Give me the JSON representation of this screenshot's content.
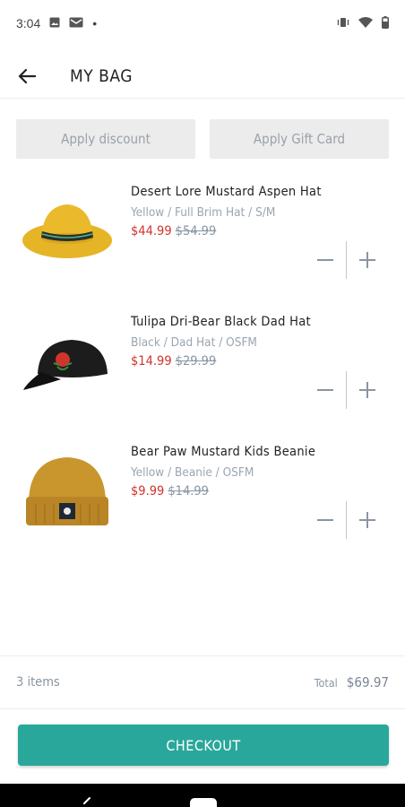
{
  "status_bar": {
    "time": "3:04",
    "dot": "•"
  },
  "header": {
    "title": "MY BAG"
  },
  "actions": {
    "discount_label": "Apply discount",
    "gift_card_label": "Apply Gift Card"
  },
  "items": [
    {
      "name": "Desert Lore Mustard Aspen Hat",
      "variant": "Yellow / Full Brim Hat / S/M",
      "sale_price": "$44.99",
      "original_price": "$54.99",
      "image": "yellow-brim-hat"
    },
    {
      "name": "Tulipa Dri-Bear Black Dad Hat",
      "variant": "Black / Dad Hat / OSFM",
      "sale_price": "$14.99",
      "original_price": "$29.99",
      "image": "black-dad-hat"
    },
    {
      "name": "Bear Paw Mustard Kids Beanie",
      "variant": "Yellow / Beanie / OSFM",
      "sale_price": "$9.99",
      "original_price": "$14.99",
      "image": "mustard-beanie"
    }
  ],
  "summary": {
    "items_count": "3 items",
    "total_label": "Total",
    "total_value": "$69.97"
  },
  "checkout": {
    "label": "CHECKOUT"
  },
  "colors": {
    "accent": "#2aa79b",
    "sale": "#d0342c",
    "muted": "#8a96a2"
  },
  "icons": [
    "arrow-left-icon",
    "minus-icon",
    "plus-icon",
    "wifi-icon",
    "battery-icon",
    "vibrate-icon",
    "image-icon",
    "mail-icon"
  ]
}
